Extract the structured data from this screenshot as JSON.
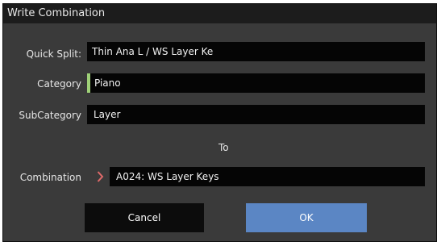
{
  "dialog": {
    "title": "Write Combination",
    "quick_split": {
      "label": "Quick Split:",
      "value": "Thin Ana L / WS Layer Ke"
    },
    "category": {
      "label": "Category",
      "value": "Piano",
      "color_mark": "#9fd178"
    },
    "subcategory": {
      "label": "SubCategory",
      "value": "Layer"
    },
    "to_label": "To",
    "combination": {
      "label": "Combination",
      "value": "A024: WS Layer Keys",
      "arrow_icon": "chevron-right-icon"
    },
    "buttons": {
      "cancel": "Cancel",
      "ok": "OK"
    }
  }
}
